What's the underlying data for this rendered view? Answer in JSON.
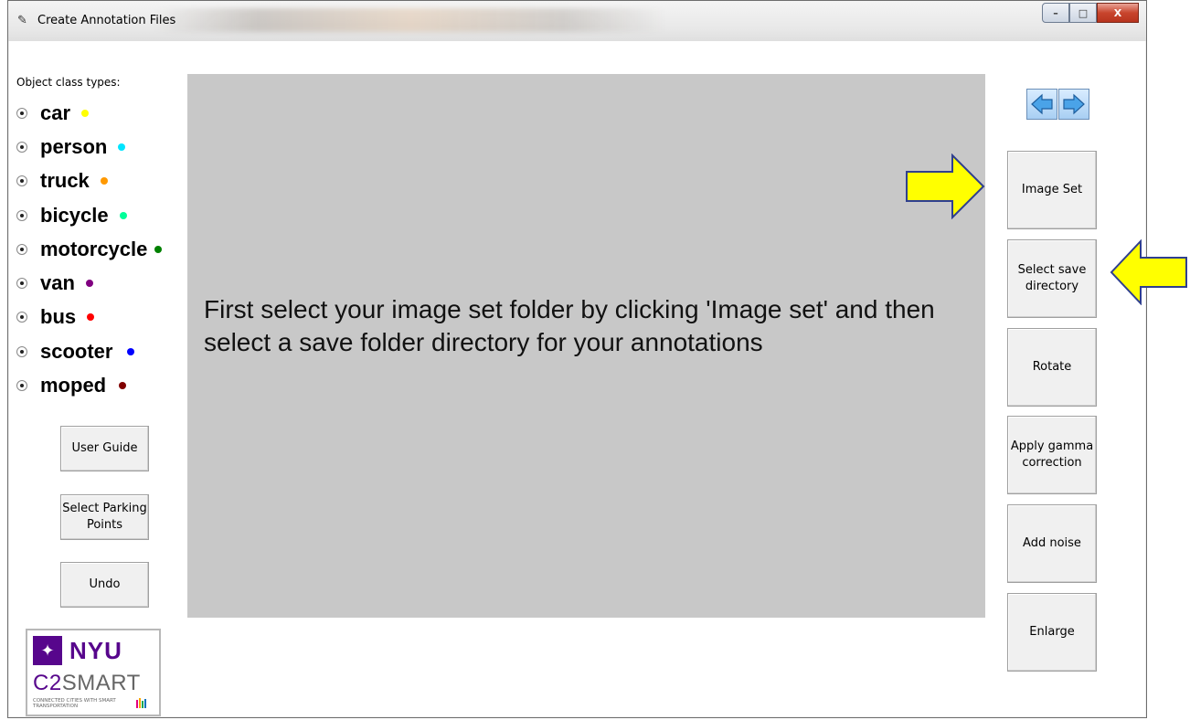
{
  "window": {
    "title": "Create Annotation Files",
    "controls": {
      "minimize": "–",
      "maximize": "□",
      "close": "X"
    }
  },
  "sidebar": {
    "heading": "Object class types:",
    "classes": [
      {
        "label": "car",
        "color": "#ffff00"
      },
      {
        "label": "person",
        "color": "#00e5ff"
      },
      {
        "label": "truck",
        "color": "#ff9900"
      },
      {
        "label": "bicycle",
        "color": "#00ff99"
      },
      {
        "label": "motorcycle",
        "color": "#008000"
      },
      {
        "label": "van",
        "color": "#800080"
      },
      {
        "label": "bus",
        "color": "#ff0000"
      },
      {
        "label": "scooter",
        "color": "#0000ff"
      },
      {
        "label": "moped",
        "color": "#800000"
      }
    ],
    "buttons": {
      "user_guide": "User Guide",
      "parking_points": "Select Parking Points",
      "undo": "Undo"
    }
  },
  "canvas": {
    "instructions": "First select your image set folder by clicking 'Image  set' and then  select a save folder directory for your annotations"
  },
  "nav": {
    "prev_icon": "arrow-left-icon",
    "next_icon": "arrow-right-icon"
  },
  "right_panel": {
    "image_set": "Image Set",
    "save_dir": "Select save directory",
    "rotate": "Rotate",
    "gamma": "Apply gamma correction",
    "noise": "Add noise",
    "enlarge": "Enlarge"
  },
  "logo": {
    "nyu": "NYU",
    "c2": "C2",
    "smart": "SMART",
    "subtitle": "CONNECTED CITIES WITH SMART TRANSPORTATION",
    "brand_color": "#57068c"
  },
  "annotation_arrows": {
    "color": "#ffff00",
    "outline": "#2f3f8f"
  }
}
